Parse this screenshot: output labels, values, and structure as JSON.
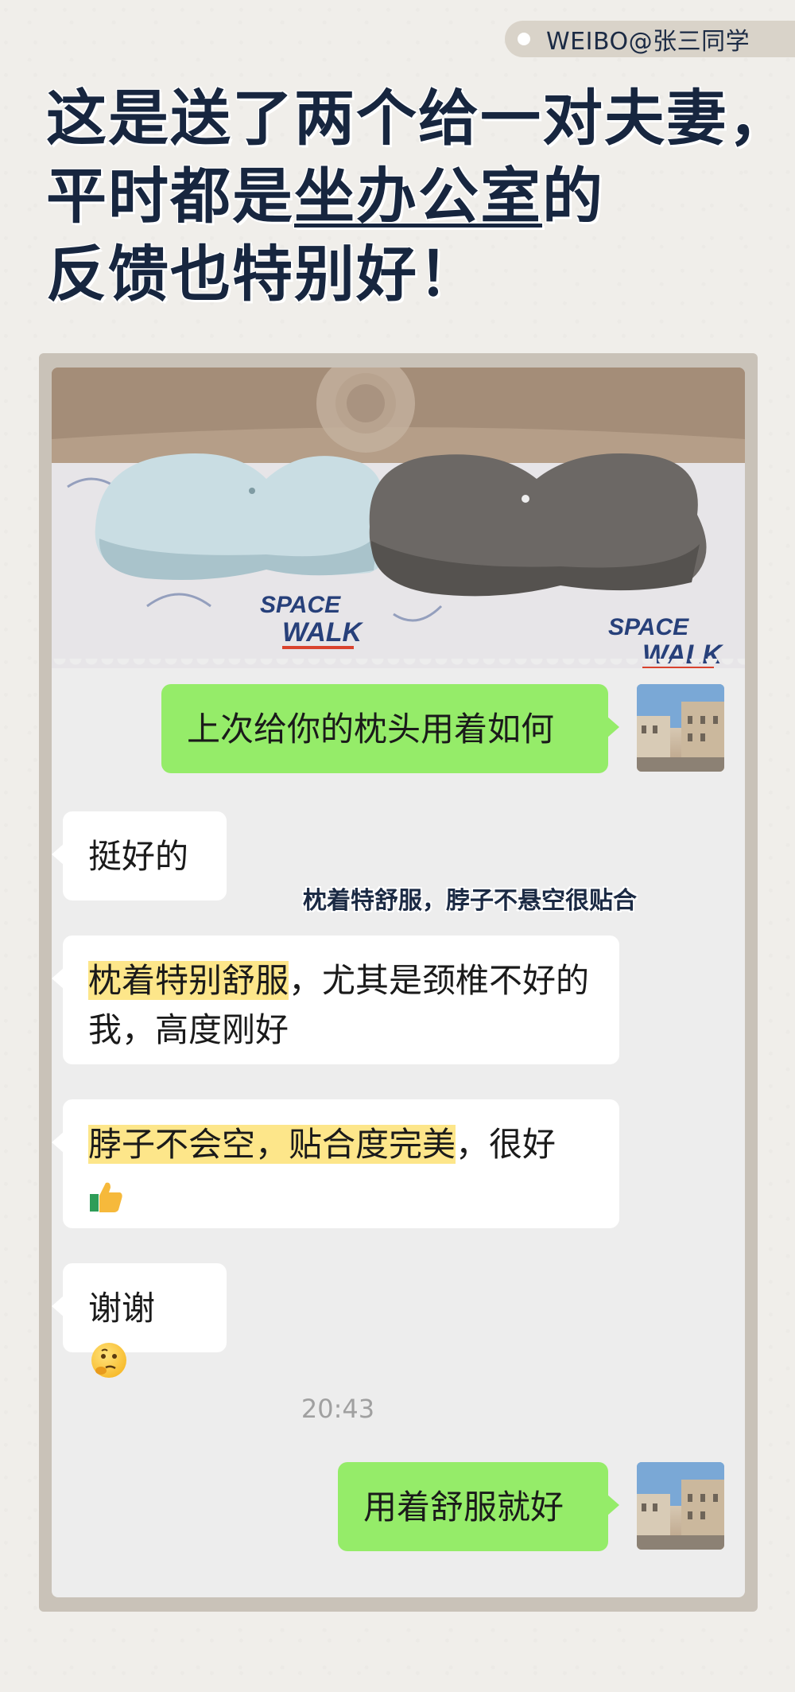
{
  "watermark": {
    "text": "WEIBO@张三同学"
  },
  "headline": {
    "line1": "这是送了两个给一对夫妻，",
    "line2_pre": "平时都是",
    "line2_underlined": "坐办公室",
    "line2_post": "的",
    "line3": "反馈也特别好！"
  },
  "photo": {
    "print_text_1": "SPACE",
    "print_text_2": "WALK",
    "print_text_3": "SPACE",
    "print_text_4": "WALK"
  },
  "chat": {
    "msg1": "上次给你的枕头用着如何",
    "msg2": "挺好的",
    "annotation": "枕着特舒服，脖子不悬空很贴合",
    "msg3_highlight": "枕着特别舒服",
    "msg3_rest": "，尤其是颈椎不好的我，高度刚好",
    "msg4_highlight": "脖子不会空，贴合度完美",
    "msg4_rest": "，很好",
    "msg5": "谢谢",
    "timestamp": "20:43",
    "msg6": "用着舒服就好"
  },
  "icons": [
    "thumbs-up-icon",
    "thinking-face-icon"
  ],
  "colors": {
    "green_bubble": "#95ec69",
    "highlight": "#fde68a",
    "headline": "#17263f"
  }
}
